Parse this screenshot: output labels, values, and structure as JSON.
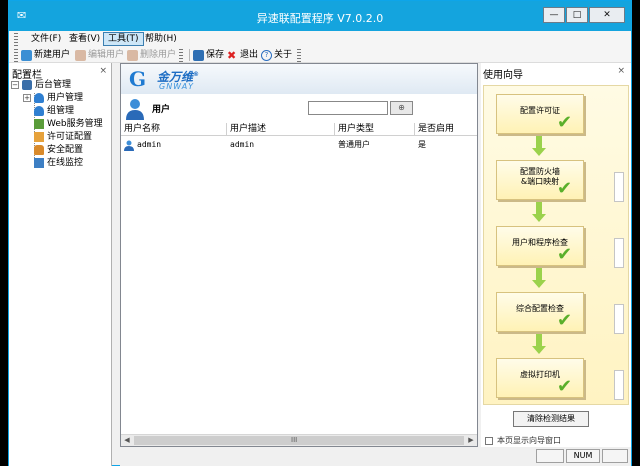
{
  "window": {
    "title": "异速联配置程序 V7.0.2.0",
    "buttons": {
      "minimize": "—",
      "maximize": "□",
      "close": "✕"
    }
  },
  "menu": {
    "file": "文件(F)",
    "view": "查看(V)",
    "tools": "工具(T)",
    "help": "帮助(H)"
  },
  "toolbar": {
    "new_user": "新建用户",
    "edit_user": "编辑用户",
    "delete_user": "删除用户",
    "save": "保存",
    "exit": "退出",
    "about": "关于"
  },
  "config_panel": {
    "title": "配置栏",
    "close": "×",
    "tree": {
      "root": "后台管理",
      "user_mgmt": "用户管理",
      "group_mgmt": "组管理",
      "web_service": "Web服务管理",
      "license": "许可证配置",
      "security": "安全配置",
      "online_monitor": "在线监控"
    }
  },
  "main": {
    "brand_cn": "金万维",
    "brand_reg": "®",
    "brand_en": "GNWAY",
    "section_label": "用户",
    "search_value": "",
    "columns": [
      "用户名称",
      "用户描述",
      "用户类型",
      "是否启用"
    ],
    "rows": [
      {
        "name": "admin",
        "desc": "admin",
        "type": "普通用户",
        "enabled": "是"
      }
    ],
    "scroll_grip": "III"
  },
  "guide_panel": {
    "title": "使用向导",
    "close": "×",
    "steps": [
      "配置许可证",
      "配置防火墙\n&端口映射",
      "用户和程序检查",
      "综合配置检查",
      "虚拟打印机"
    ],
    "clear_button": "清除检测结果",
    "checkbox_label": "本页显示向导窗口"
  },
  "status": {
    "num": "NUM"
  },
  "colors": {
    "titlebar": "#14a4de",
    "check": "#5aaf2a",
    "connector": "#9bd24c",
    "brand": "#1f6ec4"
  }
}
